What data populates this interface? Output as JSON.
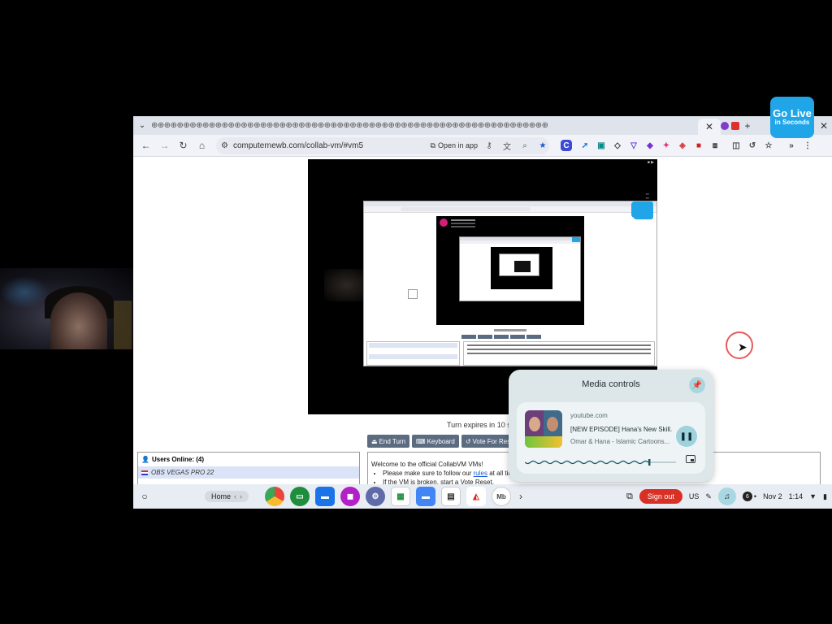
{
  "golive": {
    "line1": "Go Live",
    "line2": "in Seconds"
  },
  "browser": {
    "tab_repeat": "⊕⊕⊕⊕⊕⊕⊕⊕⊕⊕⊕⊕⊕⊕⊕⊕⊕⊕⊕⊕⊕⊕⊕⊕⊕⊕⊕⊕⊕⊕⊕⊕⊕⊕⊕⊕⊕⊕⊕⊕⊕⊕⊕⊕⊕⊕⊕⊕⊕⊕⊕⊕⊕⊕⊕⊕⊕⊕⊕⊕⊕⊕",
    "url": "computernewb.com/collab-vm/#vm5",
    "open_in_app": "Open in app"
  },
  "vm": {
    "turn_text": "Turn expires in 10 seco",
    "buttons": [
      {
        "label": "End Turn"
      },
      {
        "label": "Keyboard"
      },
      {
        "label": "Vote For Reset"
      }
    ]
  },
  "users": {
    "title": "Users Online: (4)",
    "rows": [
      {
        "name": "OBS VEGAS PRO 22"
      }
    ]
  },
  "chat": {
    "welcome": "Welcome to the official CollabVM VMs!",
    "rule1_pre": "Please make sure to follow our",
    "rule1_link": "rules",
    "rule1_post": "at all times.",
    "rule2": "If the VM is broken, start a Vote Reset."
  },
  "media": {
    "title": "Media controls",
    "source": "youtube.com",
    "song": "[NEW EPISODE] Hana's New Skill...",
    "artist": "Omar & Hana - Islamic Cartoons...",
    "progress": 0.82
  },
  "shelf": {
    "home": "Home",
    "sign_out": "Sign out",
    "locale": "US",
    "notif_count": "6",
    "date": "Nov 2",
    "time": "1:14"
  },
  "colors": {
    "accent": "#1fa5e8",
    "signout": "#d93025",
    "media_bg": "#dde7e9"
  }
}
